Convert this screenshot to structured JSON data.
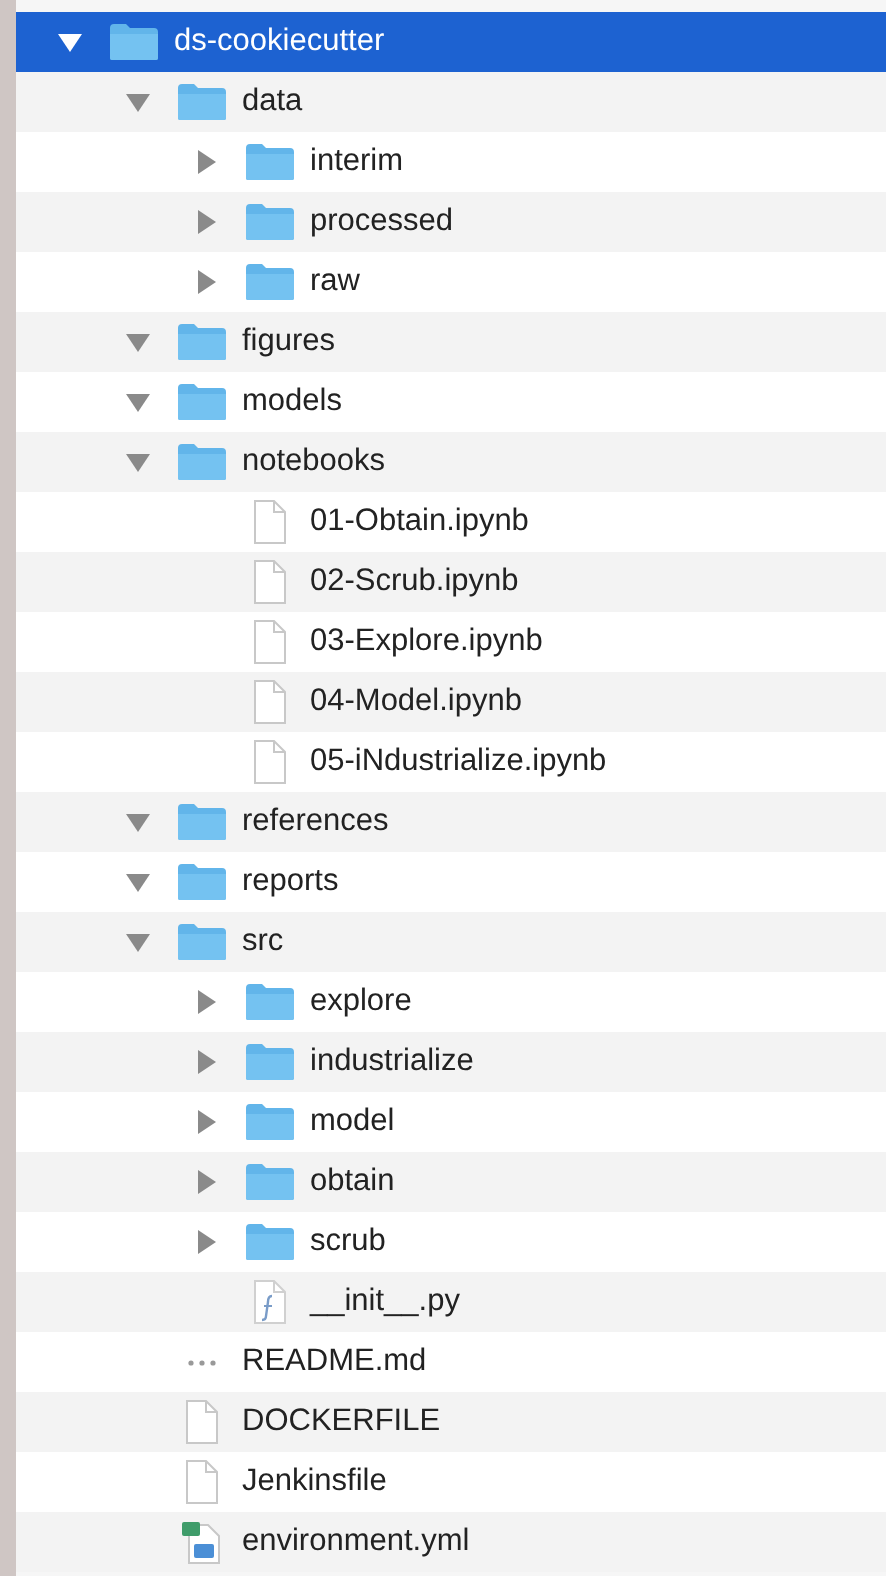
{
  "tree": [
    {
      "name": "ds-cookiecutter",
      "kind": "folder",
      "expanded": true,
      "selected": true,
      "children": [
        {
          "name": "data",
          "kind": "folder",
          "expanded": true,
          "selected": false,
          "children": [
            {
              "name": "interim",
              "kind": "folder",
              "expanded": false,
              "selected": false
            },
            {
              "name": "processed",
              "kind": "folder",
              "expanded": false,
              "selected": false
            },
            {
              "name": "raw",
              "kind": "folder",
              "expanded": false,
              "selected": false
            }
          ]
        },
        {
          "name": "figures",
          "kind": "folder",
          "expanded": true,
          "selected": false
        },
        {
          "name": "models",
          "kind": "folder",
          "expanded": true,
          "selected": false
        },
        {
          "name": "notebooks",
          "kind": "folder",
          "expanded": true,
          "selected": false,
          "children": [
            {
              "name": "01-Obtain.ipynb",
              "kind": "file",
              "selected": false
            },
            {
              "name": "02-Scrub.ipynb",
              "kind": "file",
              "selected": false
            },
            {
              "name": "03-Explore.ipynb",
              "kind": "file",
              "selected": false
            },
            {
              "name": "04-Model.ipynb",
              "kind": "file",
              "selected": false
            },
            {
              "name": "05-iNdustrialize.ipynb",
              "kind": "file",
              "selected": false
            }
          ]
        },
        {
          "name": "references",
          "kind": "folder",
          "expanded": true,
          "selected": false
        },
        {
          "name": "reports",
          "kind": "folder",
          "expanded": true,
          "selected": false
        },
        {
          "name": "src",
          "kind": "folder",
          "expanded": true,
          "selected": false,
          "children": [
            {
              "name": "explore",
              "kind": "folder",
              "expanded": false,
              "selected": false
            },
            {
              "name": "industrialize",
              "kind": "folder",
              "expanded": false,
              "selected": false
            },
            {
              "name": "model",
              "kind": "folder",
              "expanded": false,
              "selected": false
            },
            {
              "name": "obtain",
              "kind": "folder",
              "expanded": false,
              "selected": false
            },
            {
              "name": "scrub",
              "kind": "folder",
              "expanded": false,
              "selected": false
            },
            {
              "name": "__init__.py",
              "kind": "python",
              "selected": false
            }
          ]
        },
        {
          "name": "README.md",
          "kind": "markdown",
          "selected": false
        },
        {
          "name": "DOCKERFILE",
          "kind": "file",
          "selected": false
        },
        {
          "name": "Jenkinsfile",
          "kind": "file",
          "selected": false
        },
        {
          "name": "environment.yml",
          "kind": "yaml",
          "selected": false
        }
      ]
    }
  ]
}
